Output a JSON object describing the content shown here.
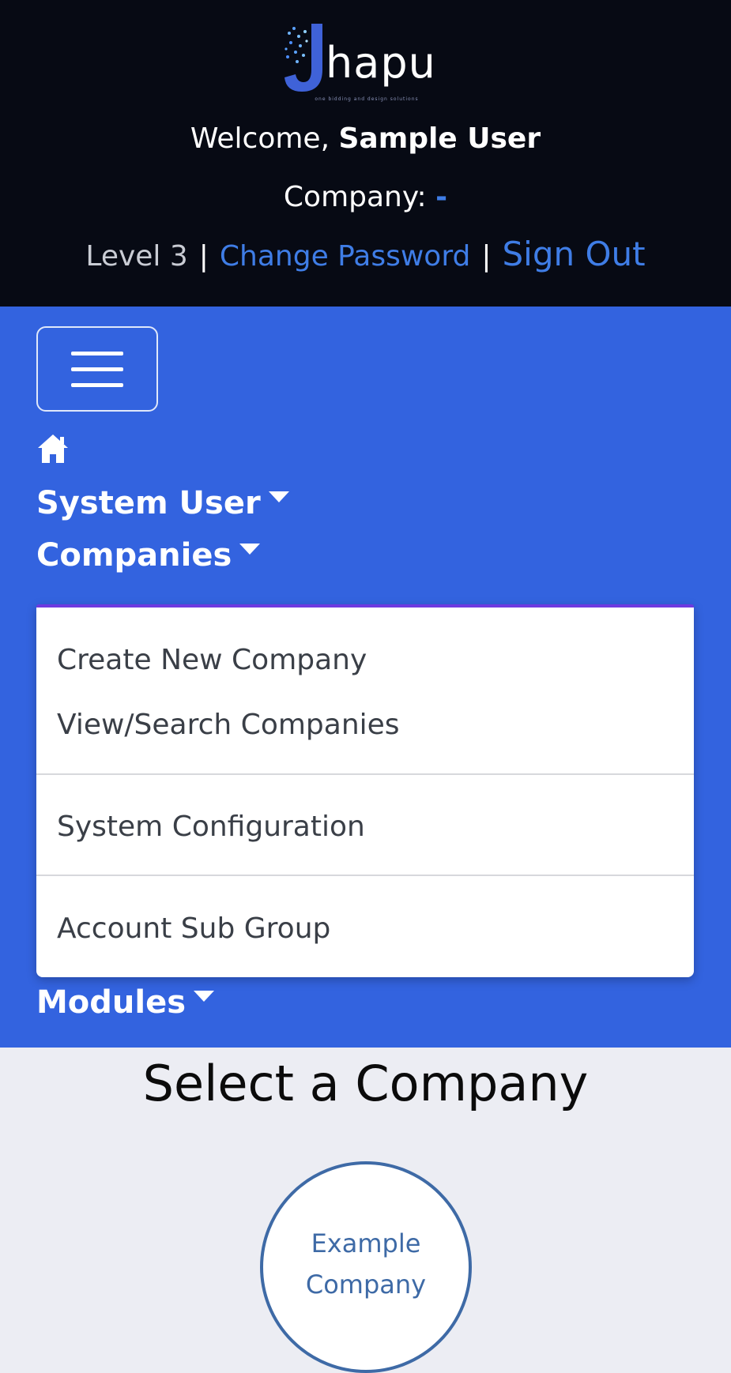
{
  "header": {
    "logo_text": "hapu",
    "logo_tagline": "one bidding and design solutions",
    "welcome_prefix": "Welcome,",
    "user_name": "Sample User",
    "company_label": "Company:",
    "company_value": "-",
    "level": "Level 3",
    "separator": "|",
    "change_password": "Change Password",
    "sign_out": "Sign Out"
  },
  "nav": {
    "system_user": "System User",
    "companies": "Companies",
    "modules": "Modules",
    "companies_menu": [
      "Create New Company",
      "View/Search Companies",
      "System Configuration",
      "Account Sub Group"
    ]
  },
  "main": {
    "heading": "Select a Company",
    "company_card": "Example Company"
  },
  "colors": {
    "header_bg": "#070a14",
    "nav_bg": "#3363df",
    "link_blue": "#3f7de6",
    "page_bg": "#ecedf3",
    "card_accent": "#3e6aa6",
    "dropdown_top_border": "#6e3ae0"
  },
  "icons": {
    "home": "home-icon",
    "menu_toggle": "hamburger-icon",
    "caret": "caret-down-icon"
  }
}
